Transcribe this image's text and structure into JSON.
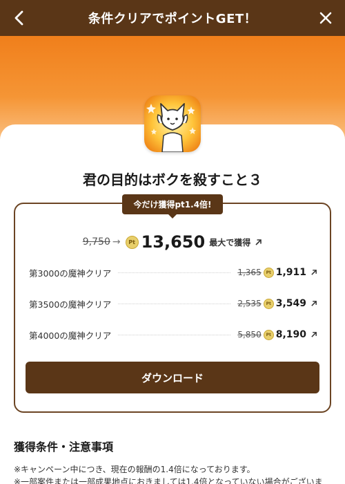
{
  "header": {
    "title": "条件クリアでポイントGET！",
    "back_icon": "chevron-left-icon",
    "close_icon": "close-icon"
  },
  "app": {
    "name": "君の目的はボクを殺すこと３",
    "icon": "white-cat-character-icon"
  },
  "campaign": {
    "badge": "今だけ獲得pt1.4倍!",
    "old_total": "9,750",
    "arrow": "→",
    "new_total": "13,650",
    "max_label": "最大で獲得"
  },
  "coin_label": "Pt",
  "tasks": [
    {
      "name": "第3000の魔神クリア",
      "old": "1,365",
      "new": "1,911"
    },
    {
      "name": "第3500の魔神クリア",
      "old": "2,535",
      "new": "3,549"
    },
    {
      "name": "第4000の魔神クリア",
      "old": "5,850",
      "new": "8,190"
    }
  ],
  "download_label": "ダウンロード",
  "conditions": {
    "title": "獲得条件・注意事項",
    "notes": [
      "※キャンペーン中につき、現在の報酬の1.4倍になっております。",
      "※一部案件または一部成果地点におきましては1.4倍となっていない場合がございま"
    ]
  },
  "colors": {
    "brown": "#5a3617",
    "orange": "#f07f1b",
    "coin": "#e8cf6b"
  }
}
